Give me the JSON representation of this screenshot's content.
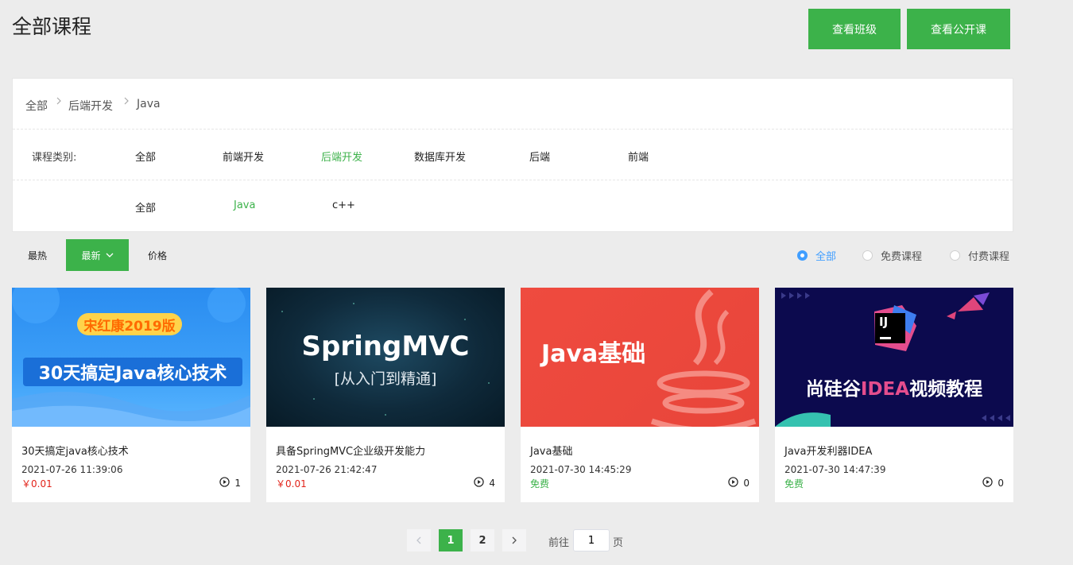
{
  "header": {
    "title": "全部课程",
    "btn_class": "查看班级",
    "btn_open": "查看公开课"
  },
  "breadcrumb": [
    "全部",
    "后端开发",
    "Java"
  ],
  "filters": {
    "label": "课程类别:",
    "level1": [
      {
        "label": "全部",
        "active": false
      },
      {
        "label": "前端开发",
        "active": false
      },
      {
        "label": "后端开发",
        "active": true
      },
      {
        "label": "数据库开发",
        "active": false
      },
      {
        "label": "后端",
        "active": false
      },
      {
        "label": "前端",
        "active": false
      }
    ],
    "level2": [
      {
        "label": "全部",
        "active": false
      },
      {
        "label": "Java",
        "active": true
      },
      {
        "label": "c++",
        "active": false
      }
    ]
  },
  "sort": {
    "hot": "最热",
    "newest": "最新",
    "price": "价格"
  },
  "price_filter": [
    {
      "label": "全部",
      "checked": true
    },
    {
      "label": "免费课程",
      "checked": false
    },
    {
      "label": "付费课程",
      "checked": false
    }
  ],
  "courses": [
    {
      "cover_badge": "宋红康2019版",
      "cover_text": "30天搞定Java核心技术",
      "title": "30天搞定java核心技术",
      "date": "2021-07-26 11:39:06",
      "price": "￥0.01",
      "free": false,
      "plays": "1"
    },
    {
      "cover_text": "SpringMVC",
      "cover_sub": "[从入门到精通]",
      "title": "具备SpringMVC企业级开发能力",
      "date": "2021-07-26 21:42:47",
      "price": "￥0.01",
      "free": false,
      "plays": "4"
    },
    {
      "cover_text": "Java基础",
      "title": "Java基础",
      "date": "2021-07-30 14:45:29",
      "price": "免费",
      "free": true,
      "plays": "0"
    },
    {
      "cover_logo": "IJ",
      "cover_text_a": "尚硅谷",
      "cover_text_b": "IDEA",
      "cover_text_c": "视频教程",
      "title": "Java开发利器IDEA",
      "date": "2021-07-30 14:47:39",
      "price": "免费",
      "free": true,
      "plays": "0"
    }
  ],
  "pagination": {
    "pages": [
      "1",
      "2"
    ],
    "current": "1",
    "goto_prefix": "前往",
    "goto_value": "1",
    "goto_suffix": "页"
  },
  "colors": {
    "accent": "#3cb24a",
    "paid": "#e2231a",
    "radio": "#409eff"
  }
}
